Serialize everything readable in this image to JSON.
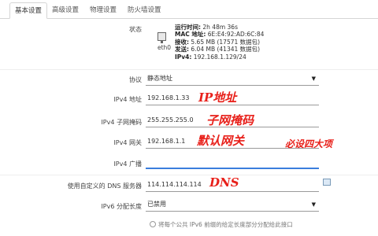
{
  "tabs": [
    {
      "label": "基本设置",
      "active": true
    },
    {
      "label": "高级设置",
      "active": false
    },
    {
      "label": "物理设置",
      "active": false
    },
    {
      "label": "防火墙设置",
      "active": false
    }
  ],
  "status": {
    "label": "状态",
    "iface": "eth0",
    "uptime_key": "运行时间:",
    "uptime_val": "2h 48m 36s",
    "mac_key": "MAC 地址:",
    "mac_val": "6E:E4:92:AD:6C:84",
    "rx_key": "接收:",
    "rx_val": "5.65 MB (17571 数据包)",
    "tx_key": "发送:",
    "tx_val": "6.04 MB (41341 数据包)",
    "ipv4_key": "IPv4:",
    "ipv4_val": "192.168.1.129/24"
  },
  "protocol": {
    "label": "协议",
    "value": "静态地址"
  },
  "ipv4_addr": {
    "label": "IPv4 地址",
    "value": "192.168.1.33",
    "annotation": "IP地址"
  },
  "netmask": {
    "label": "IPv4 子网掩码",
    "value": "255.255.255.0",
    "annotation": "子网掩码"
  },
  "gateway": {
    "label": "IPv4 网关",
    "value": "192.168.1.1",
    "annotation": "默认网关"
  },
  "side_note": "必设四大项",
  "broadcast": {
    "label": "IPv4 广播",
    "value": ""
  },
  "dns": {
    "label": "使用自定义的 DNS 服务器",
    "value": "114.114.114.114",
    "annotation": "DNS"
  },
  "ipv6_prefix": {
    "label": "IPv6 分配长度",
    "value": "已禁用"
  },
  "hint": "将每个公共 IPv6 前缀的给定长度部分分配给此接口",
  "colors": {
    "accent": "#3b7ddd",
    "annotation": "#e8201a"
  }
}
